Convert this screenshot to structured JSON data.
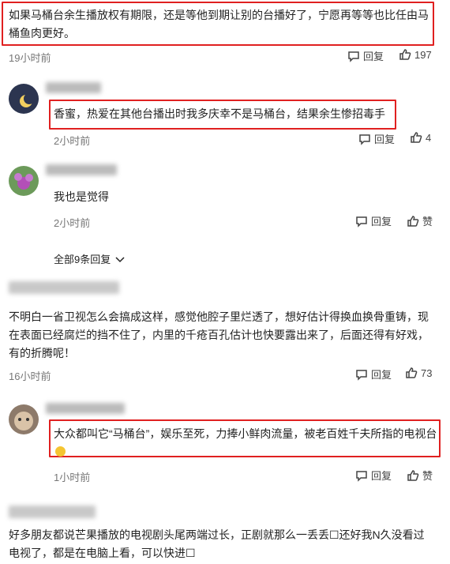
{
  "comments": [
    {
      "text": "如果马桶台余生播放权有期限，还是等他到期让别的台播好了，宁愿再等等也比任由马桶鱼肉更好。",
      "time": "19小时前",
      "reply": "回复",
      "likes": "197"
    },
    {
      "text": "香蜜，热爱在其他台播出时我多庆幸不是马桶台，结果余生惨招毒手",
      "time": "2小时前",
      "reply": "回复",
      "likes": "4"
    },
    {
      "text": "我也是觉得",
      "time": "2小时前",
      "reply": "回复",
      "likes": "赞"
    },
    {
      "text": "不明白一省卫视怎么会搞成这样，感觉他腔子里烂透了，想好估计得换血换骨重铸，现在表面已经腐烂的挡不住了，内里的千疮百孔估计也快要露出来了，后面还得有好戏，有的折腾呢！",
      "time": "16小时前",
      "reply": "回复",
      "likes": "73"
    },
    {
      "text": "大众都叫它“马桶台”，娱乐至死，力捧小鲜肉流量，被老百姓千夫所指的电视台",
      "time": "1小时前",
      "reply": "回复",
      "likes": "赞"
    },
    {
      "text": "好多朋友都说芒果播放的电视剧头尾两端过长，正剧就那么一丢丢☐还好我N久没看过电视了，都是在电脑上看，可以快进☐"
    }
  ],
  "expand_replies": "全部9条回复",
  "colors": {
    "highlight": "#e02020",
    "meta": "#777777"
  }
}
